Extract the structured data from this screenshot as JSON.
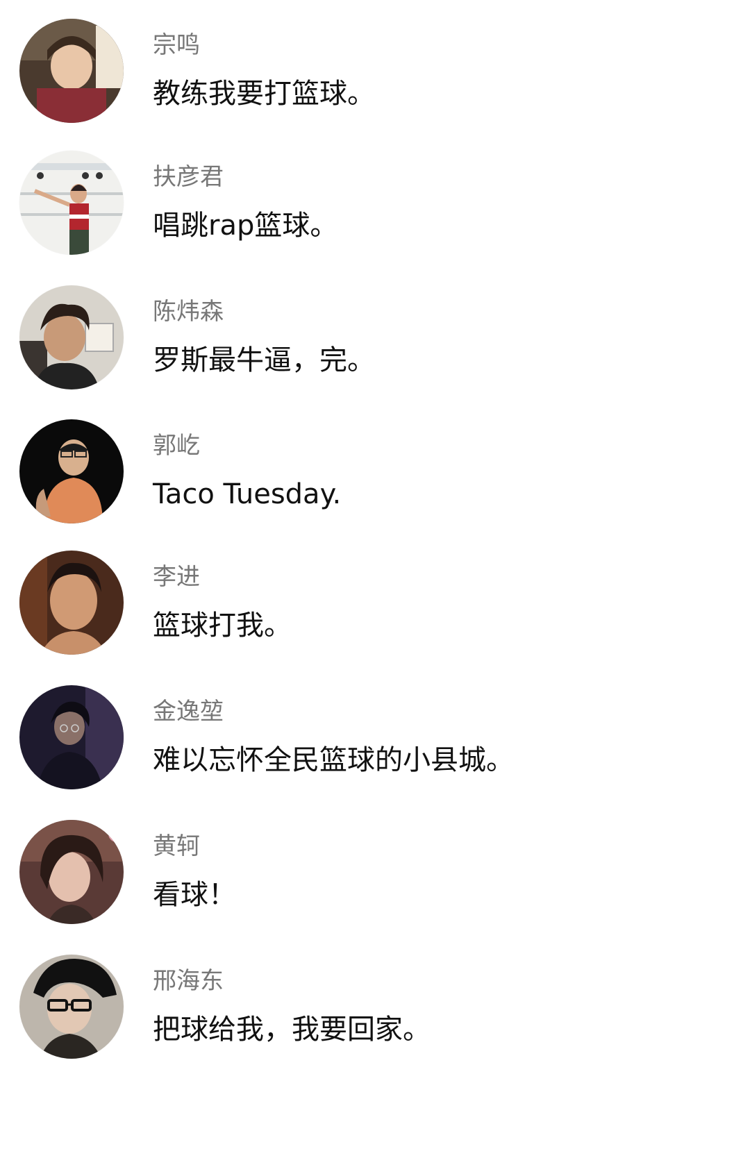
{
  "comments": [
    {
      "name": "宗鸣",
      "text": "教练我要打篮球。",
      "avatar_icon": "person-avatar-icon"
    },
    {
      "name": "扶彦君",
      "text": "唱跳rap篮球。",
      "avatar_icon": "person-avatar-icon"
    },
    {
      "name": "陈炜森",
      "text": "罗斯最牛逼，完。",
      "avatar_icon": "person-avatar-icon"
    },
    {
      "name": "郭屹",
      "text": "Taco Tuesday.",
      "avatar_icon": "person-avatar-icon"
    },
    {
      "name": "李进",
      "text": "篮球打我。",
      "avatar_icon": "person-avatar-icon"
    },
    {
      "name": "金逸堃",
      "text": "难以忘怀全民篮球的小县城。",
      "avatar_icon": "person-avatar-icon"
    },
    {
      "name": "黄轲",
      "text": "看球！",
      "avatar_icon": "person-avatar-icon"
    },
    {
      "name": "邢海东",
      "text": "把球给我，我要回家。",
      "avatar_icon": "person-avatar-icon"
    }
  ]
}
